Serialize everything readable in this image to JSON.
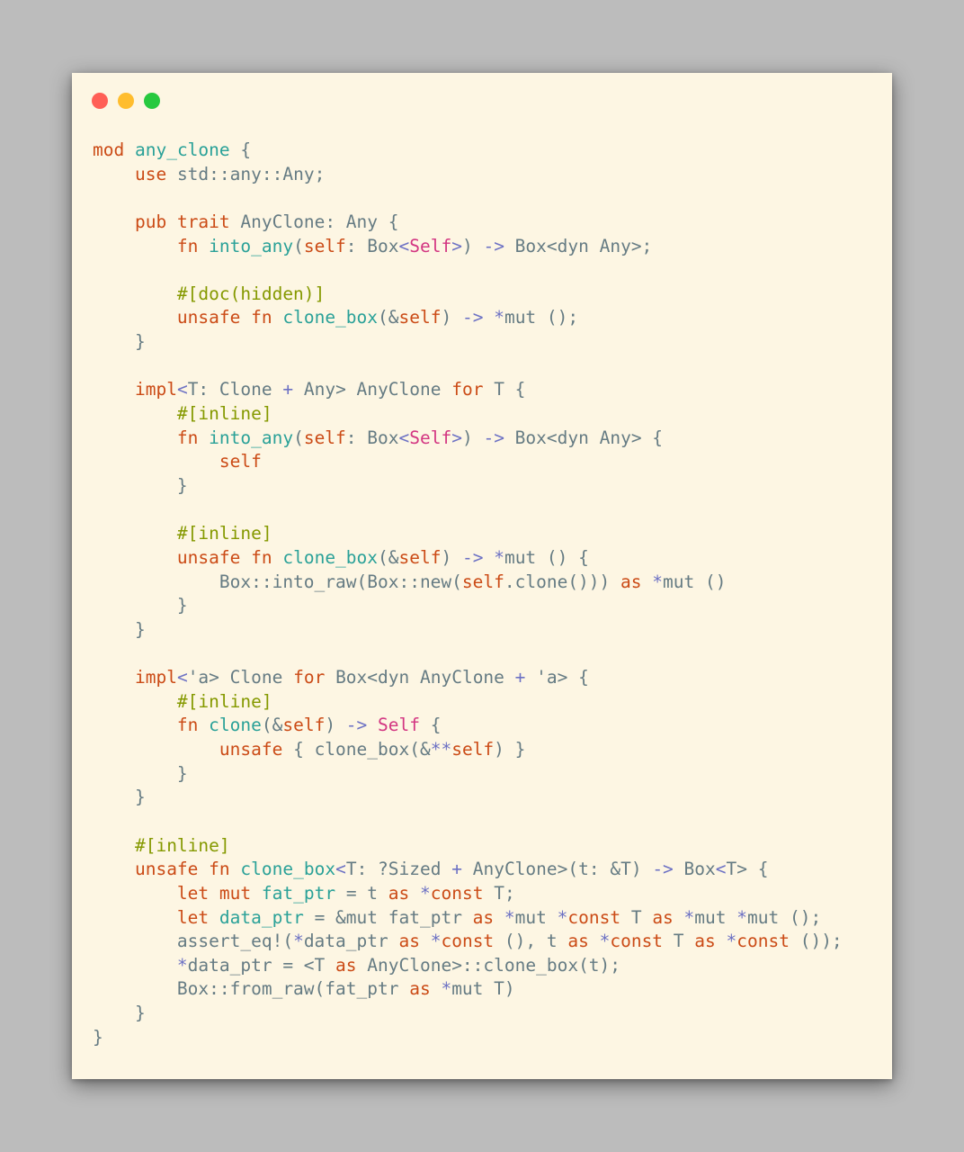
{
  "window": {
    "controls": [
      {
        "name": "close",
        "color": "#ff5f56"
      },
      {
        "name": "minimize",
        "color": "#ffbd2e"
      },
      {
        "name": "zoom",
        "color": "#27c93f"
      }
    ]
  },
  "code": {
    "lines": [
      [
        [
          "kw",
          "mod"
        ],
        [
          "plain",
          " "
        ],
        [
          "fn",
          "any_clone"
        ],
        [
          "plain",
          " {"
        ]
      ],
      [
        [
          "plain",
          "    "
        ],
        [
          "kw",
          "use"
        ],
        [
          "plain",
          " std::any::Any;"
        ]
      ],
      [],
      [
        [
          "plain",
          "    "
        ],
        [
          "kw",
          "pub"
        ],
        [
          "plain",
          " "
        ],
        [
          "kw",
          "trait"
        ],
        [
          "plain",
          " AnyClone: Any {"
        ]
      ],
      [
        [
          "plain",
          "        "
        ],
        [
          "kw",
          "fn"
        ],
        [
          "plain",
          " "
        ],
        [
          "fn",
          "into_any"
        ],
        [
          "plain",
          "("
        ],
        [
          "kw",
          "self"
        ],
        [
          "plain",
          ": Box"
        ],
        [
          "op",
          "<"
        ],
        [
          "self",
          "Self"
        ],
        [
          "op",
          ">"
        ],
        [
          "plain",
          ") "
        ],
        [
          "op",
          "->"
        ],
        [
          "plain",
          " Box<dyn Any>;"
        ]
      ],
      [],
      [
        [
          "plain",
          "        "
        ],
        [
          "attr",
          "#[doc(hidden)]"
        ]
      ],
      [
        [
          "plain",
          "        "
        ],
        [
          "kw",
          "unsafe"
        ],
        [
          "plain",
          " "
        ],
        [
          "kw",
          "fn"
        ],
        [
          "plain",
          " "
        ],
        [
          "fn",
          "clone_box"
        ],
        [
          "plain",
          "(&"
        ],
        [
          "kw",
          "self"
        ],
        [
          "plain",
          ") "
        ],
        [
          "op",
          "->"
        ],
        [
          "plain",
          " "
        ],
        [
          "op",
          "*"
        ],
        [
          "plain",
          "mut ();"
        ]
      ],
      [
        [
          "plain",
          "    }"
        ]
      ],
      [],
      [
        [
          "plain",
          "    "
        ],
        [
          "kw",
          "impl"
        ],
        [
          "op",
          "<"
        ],
        [
          "plain",
          "T: Clone "
        ],
        [
          "op",
          "+"
        ],
        [
          "plain",
          " Any> AnyClone "
        ],
        [
          "kw",
          "for"
        ],
        [
          "plain",
          " T {"
        ]
      ],
      [
        [
          "plain",
          "        "
        ],
        [
          "attr",
          "#[inline]"
        ]
      ],
      [
        [
          "plain",
          "        "
        ],
        [
          "kw",
          "fn"
        ],
        [
          "plain",
          " "
        ],
        [
          "fn",
          "into_any"
        ],
        [
          "plain",
          "("
        ],
        [
          "kw",
          "self"
        ],
        [
          "plain",
          ": Box"
        ],
        [
          "op",
          "<"
        ],
        [
          "self",
          "Self"
        ],
        [
          "op",
          ">"
        ],
        [
          "plain",
          ") "
        ],
        [
          "op",
          "->"
        ],
        [
          "plain",
          " Box<dyn Any> {"
        ]
      ],
      [
        [
          "plain",
          "            "
        ],
        [
          "kw",
          "self"
        ]
      ],
      [
        [
          "plain",
          "        }"
        ]
      ],
      [],
      [
        [
          "plain",
          "        "
        ],
        [
          "attr",
          "#[inline]"
        ]
      ],
      [
        [
          "plain",
          "        "
        ],
        [
          "kw",
          "unsafe"
        ],
        [
          "plain",
          " "
        ],
        [
          "kw",
          "fn"
        ],
        [
          "plain",
          " "
        ],
        [
          "fn",
          "clone_box"
        ],
        [
          "plain",
          "(&"
        ],
        [
          "kw",
          "self"
        ],
        [
          "plain",
          ") "
        ],
        [
          "op",
          "->"
        ],
        [
          "plain",
          " "
        ],
        [
          "op",
          "*"
        ],
        [
          "plain",
          "mut () {"
        ]
      ],
      [
        [
          "plain",
          "            Box::into_raw(Box::new("
        ],
        [
          "kw",
          "self"
        ],
        [
          "plain",
          ".clone())) "
        ],
        [
          "kw",
          "as"
        ],
        [
          "plain",
          " "
        ],
        [
          "op",
          "*"
        ],
        [
          "plain",
          "mut ()"
        ]
      ],
      [
        [
          "plain",
          "        }"
        ]
      ],
      [
        [
          "plain",
          "    }"
        ]
      ],
      [],
      [
        [
          "plain",
          "    "
        ],
        [
          "kw",
          "impl"
        ],
        [
          "op",
          "<"
        ],
        [
          "plain",
          "'a> Clone "
        ],
        [
          "kw",
          "for"
        ],
        [
          "plain",
          " Box<dyn AnyClone "
        ],
        [
          "op",
          "+"
        ],
        [
          "plain",
          " 'a> {"
        ]
      ],
      [
        [
          "plain",
          "        "
        ],
        [
          "attr",
          "#[inline]"
        ]
      ],
      [
        [
          "plain",
          "        "
        ],
        [
          "kw",
          "fn"
        ],
        [
          "plain",
          " "
        ],
        [
          "fn",
          "clone"
        ],
        [
          "plain",
          "(&"
        ],
        [
          "kw",
          "self"
        ],
        [
          "plain",
          ") "
        ],
        [
          "op",
          "->"
        ],
        [
          "plain",
          " "
        ],
        [
          "self",
          "Self"
        ],
        [
          "plain",
          " {"
        ]
      ],
      [
        [
          "plain",
          "            "
        ],
        [
          "kw",
          "unsafe"
        ],
        [
          "plain",
          " { clone_box(&"
        ],
        [
          "op",
          "**"
        ],
        [
          "kw",
          "self"
        ],
        [
          "plain",
          ") }"
        ]
      ],
      [
        [
          "plain",
          "        }"
        ]
      ],
      [
        [
          "plain",
          "    }"
        ]
      ],
      [],
      [
        [
          "plain",
          "    "
        ],
        [
          "attr",
          "#[inline]"
        ]
      ],
      [
        [
          "plain",
          "    "
        ],
        [
          "kw",
          "unsafe"
        ],
        [
          "plain",
          " "
        ],
        [
          "kw",
          "fn"
        ],
        [
          "plain",
          " "
        ],
        [
          "fn",
          "clone_box"
        ],
        [
          "op",
          "<"
        ],
        [
          "plain",
          "T: ?Sized "
        ],
        [
          "op",
          "+"
        ],
        [
          "plain",
          " AnyClone>(t: &T) "
        ],
        [
          "op",
          "->"
        ],
        [
          "plain",
          " Box"
        ],
        [
          "op",
          "<"
        ],
        [
          "plain",
          "T> {"
        ]
      ],
      [
        [
          "plain",
          "        "
        ],
        [
          "kw",
          "let"
        ],
        [
          "plain",
          " "
        ],
        [
          "kw",
          "mut"
        ],
        [
          "plain",
          " "
        ],
        [
          "fn",
          "fat_ptr"
        ],
        [
          "plain",
          " = t "
        ],
        [
          "kw",
          "as"
        ],
        [
          "plain",
          " "
        ],
        [
          "op",
          "*"
        ],
        [
          "kw",
          "const"
        ],
        [
          "plain",
          " T;"
        ]
      ],
      [
        [
          "plain",
          "        "
        ],
        [
          "kw",
          "let"
        ],
        [
          "plain",
          " "
        ],
        [
          "fn",
          "data_ptr"
        ],
        [
          "plain",
          " = &mut fat_ptr "
        ],
        [
          "kw",
          "as"
        ],
        [
          "plain",
          " "
        ],
        [
          "op",
          "*"
        ],
        [
          "plain",
          "mut "
        ],
        [
          "op",
          "*"
        ],
        [
          "kw",
          "const"
        ],
        [
          "plain",
          " T "
        ],
        [
          "kw",
          "as"
        ],
        [
          "plain",
          " "
        ],
        [
          "op",
          "*"
        ],
        [
          "plain",
          "mut "
        ],
        [
          "op",
          "*"
        ],
        [
          "plain",
          "mut ();"
        ]
      ],
      [
        [
          "plain",
          "        assert_eq!("
        ],
        [
          "op",
          "*"
        ],
        [
          "plain",
          "data_ptr "
        ],
        [
          "kw",
          "as"
        ],
        [
          "plain",
          " "
        ],
        [
          "op",
          "*"
        ],
        [
          "kw",
          "const"
        ],
        [
          "plain",
          " (), t "
        ],
        [
          "kw",
          "as"
        ],
        [
          "plain",
          " "
        ],
        [
          "op",
          "*"
        ],
        [
          "kw",
          "const"
        ],
        [
          "plain",
          " T "
        ],
        [
          "kw",
          "as"
        ],
        [
          "plain",
          " "
        ],
        [
          "op",
          "*"
        ],
        [
          "kw",
          "const"
        ],
        [
          "plain",
          " ());"
        ]
      ],
      [
        [
          "plain",
          "        "
        ],
        [
          "op",
          "*"
        ],
        [
          "plain",
          "data_ptr = <T "
        ],
        [
          "kw",
          "as"
        ],
        [
          "plain",
          " AnyClone>::clone_box(t);"
        ]
      ],
      [
        [
          "plain",
          "        Box::from_raw(fat_ptr "
        ],
        [
          "kw",
          "as"
        ],
        [
          "plain",
          " "
        ],
        [
          "op",
          "*"
        ],
        [
          "plain",
          "mut T)"
        ]
      ],
      [
        [
          "plain",
          "    }"
        ]
      ],
      [
        [
          "plain",
          "}"
        ]
      ]
    ]
  }
}
